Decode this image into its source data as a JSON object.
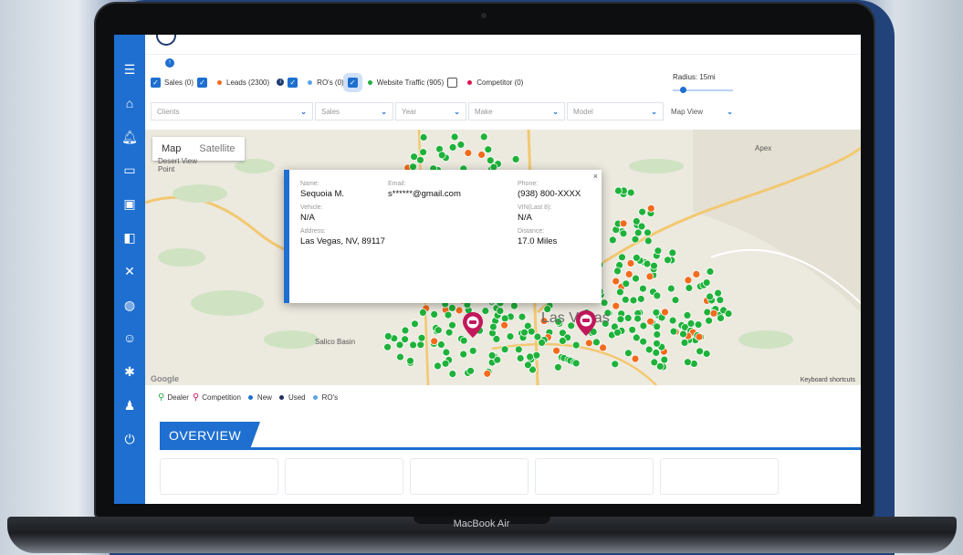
{
  "colors": {
    "accent": "#1e6fd0",
    "sales_dot": "#f26b1d",
    "leads_dot": "#1e3c72",
    "ros_dot": "#58a6e6",
    "traffic_dot": "#1fb23a",
    "competitor_dot": "#e0154e"
  },
  "sidebar": {
    "icons": [
      "list-check-icon",
      "home-icon",
      "bell-icon",
      "card-icon",
      "id-card-icon",
      "ad-icon",
      "tools-icon",
      "globe-icon",
      "users-icon",
      "gear-icon",
      "user-settings-icon",
      "power-icon"
    ]
  },
  "filters": {
    "sales": "Sales (0)",
    "leads": "Leads (2300)",
    "ros": "RO's (0)",
    "traffic": "Website Traffic (905)",
    "competitor": "Competitor (0)",
    "radius": "Radius: 15mi"
  },
  "selects": {
    "clients": "Clients",
    "sales": "Sales",
    "year": "Year",
    "make": "Make",
    "model": "Model",
    "map_view": "Map View"
  },
  "map": {
    "tab_map": "Map",
    "tab_satellite": "Satellite",
    "city": "Las Vegas",
    "places": {
      "desert_view": "Desert View Point",
      "salico": "Salico Basin",
      "apex": "Apex",
      "keyboard": "Keyboard shortcuts",
      "google": "Google"
    }
  },
  "popup": {
    "name_label": "Name:",
    "name": "Sequoia M.",
    "email_label": "Email:",
    "email": "s******@gmail.com",
    "phone_label": "Phone:",
    "phone": "(938) 800-XXXX",
    "vehicle_label": "Vehicle:",
    "vehicle": "N/A",
    "vin_label": "VIN(Last 8):",
    "vin": "N/A",
    "address_label": "Address:",
    "address": "Las Vegas, NV, 89117",
    "distance_label": "Distance:",
    "distance": "17.0 Miles",
    "close": "×"
  },
  "legend": {
    "dealer": "Dealer",
    "competition": "Competition",
    "new": "New",
    "used": "Used",
    "ros": "RO's"
  },
  "overview": {
    "title": "OVERVIEW"
  },
  "laptop": {
    "label": "MacBook Air"
  }
}
